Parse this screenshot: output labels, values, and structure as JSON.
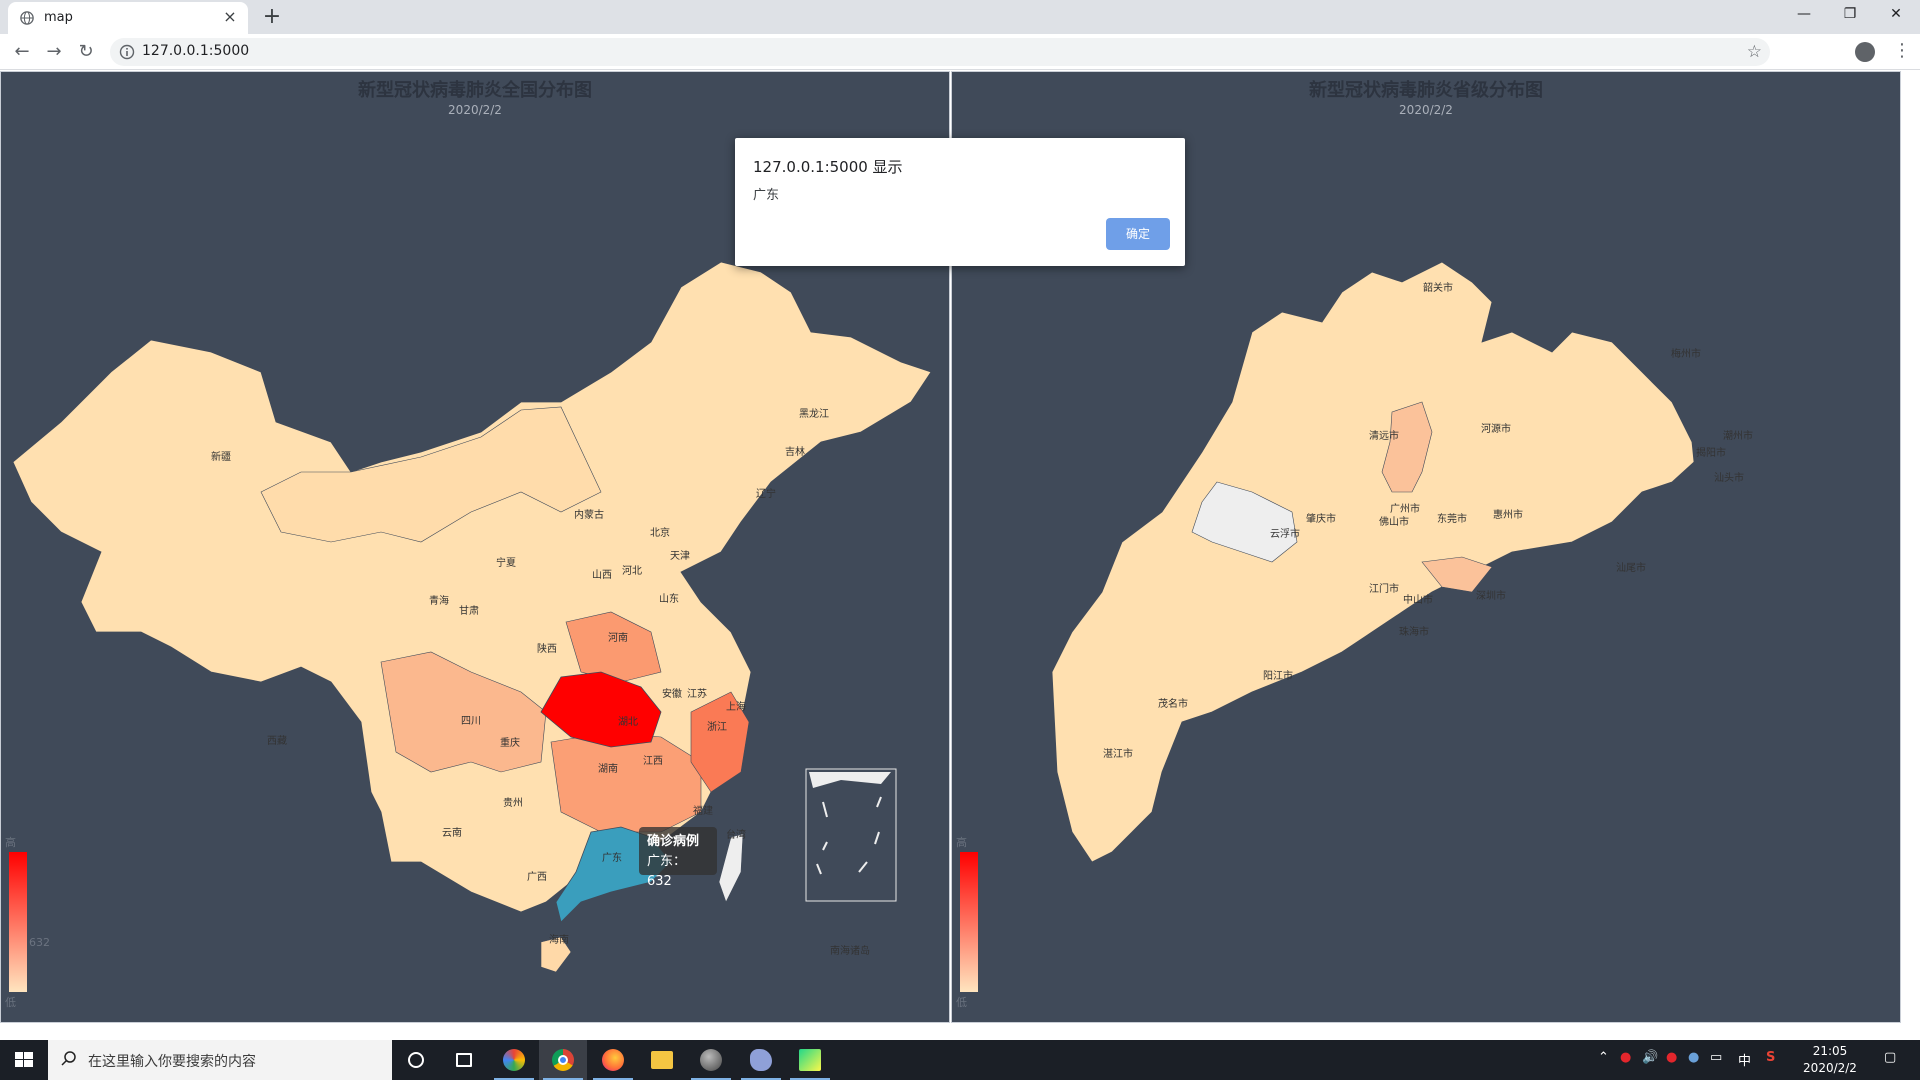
{
  "browser": {
    "tab_title": "map",
    "tab_close_icon": "×",
    "new_tab_icon": "+",
    "url": "127.0.0.1:5000",
    "window_controls": {
      "minimize": "—",
      "restore": "❐",
      "close": "✕"
    },
    "nav": {
      "back": "←",
      "forward": "→",
      "reload": "↻"
    },
    "bookmark_icon": "☆",
    "menu_icon": "⋮"
  },
  "left_chart": {
    "title": "新型冠状病毒肺炎全国分布图",
    "date": "2020/2/2",
    "legend": {
      "high": "高",
      "low": "低",
      "indicator_value": "632"
    },
    "labels": [
      "新疆",
      "西藏",
      "青海",
      "甘肃",
      "内蒙古",
      "宁夏",
      "陕西",
      "山西",
      "河北",
      "北京",
      "天津",
      "山东",
      "河南",
      "湖北",
      "安徽",
      "江苏",
      "上海",
      "浙江",
      "四川",
      "重庆",
      "湖南",
      "江西",
      "贵州",
      "云南",
      "广西",
      "广东",
      "福建",
      "台湾",
      "海南",
      "黑龙江",
      "吉林",
      "辽宁",
      "南海诸岛"
    ],
    "tooltip": {
      "title": "确诊病例",
      "text": "广东：632"
    }
  },
  "right_chart": {
    "title": "新型冠状病毒肺炎省级分布图",
    "date": "2020/2/2",
    "legend": {
      "high": "高",
      "low": "低"
    },
    "labels": [
      "韶关市",
      "梅州市",
      "清远市",
      "河源市",
      "潮州市",
      "揭阳市",
      "汕头市",
      "肇庆市",
      "广州市",
      "佛山市",
      "东莞市",
      "惠州市",
      "云浮市",
      "江门市",
      "中山市",
      "深圳市",
      "汕尾市",
      "珠海市",
      "阳江市",
      "茂名市",
      "湛江市"
    ]
  },
  "dialog": {
    "title": "127.0.0.1:5000 显示",
    "message": "广东",
    "ok_label": "确定"
  },
  "taskbar": {
    "search_placeholder": "在这里输入你要搜索的内容",
    "tray_ime": "中",
    "time": "21:05",
    "date": "2020/2/2"
  },
  "colors": {
    "map_bg": "#404a59",
    "low": "#ffe5bf",
    "mid": "#fdba8f",
    "high": "#ff0000",
    "selected": "#3a9ebd",
    "no_data": "#eeeeee"
  }
}
